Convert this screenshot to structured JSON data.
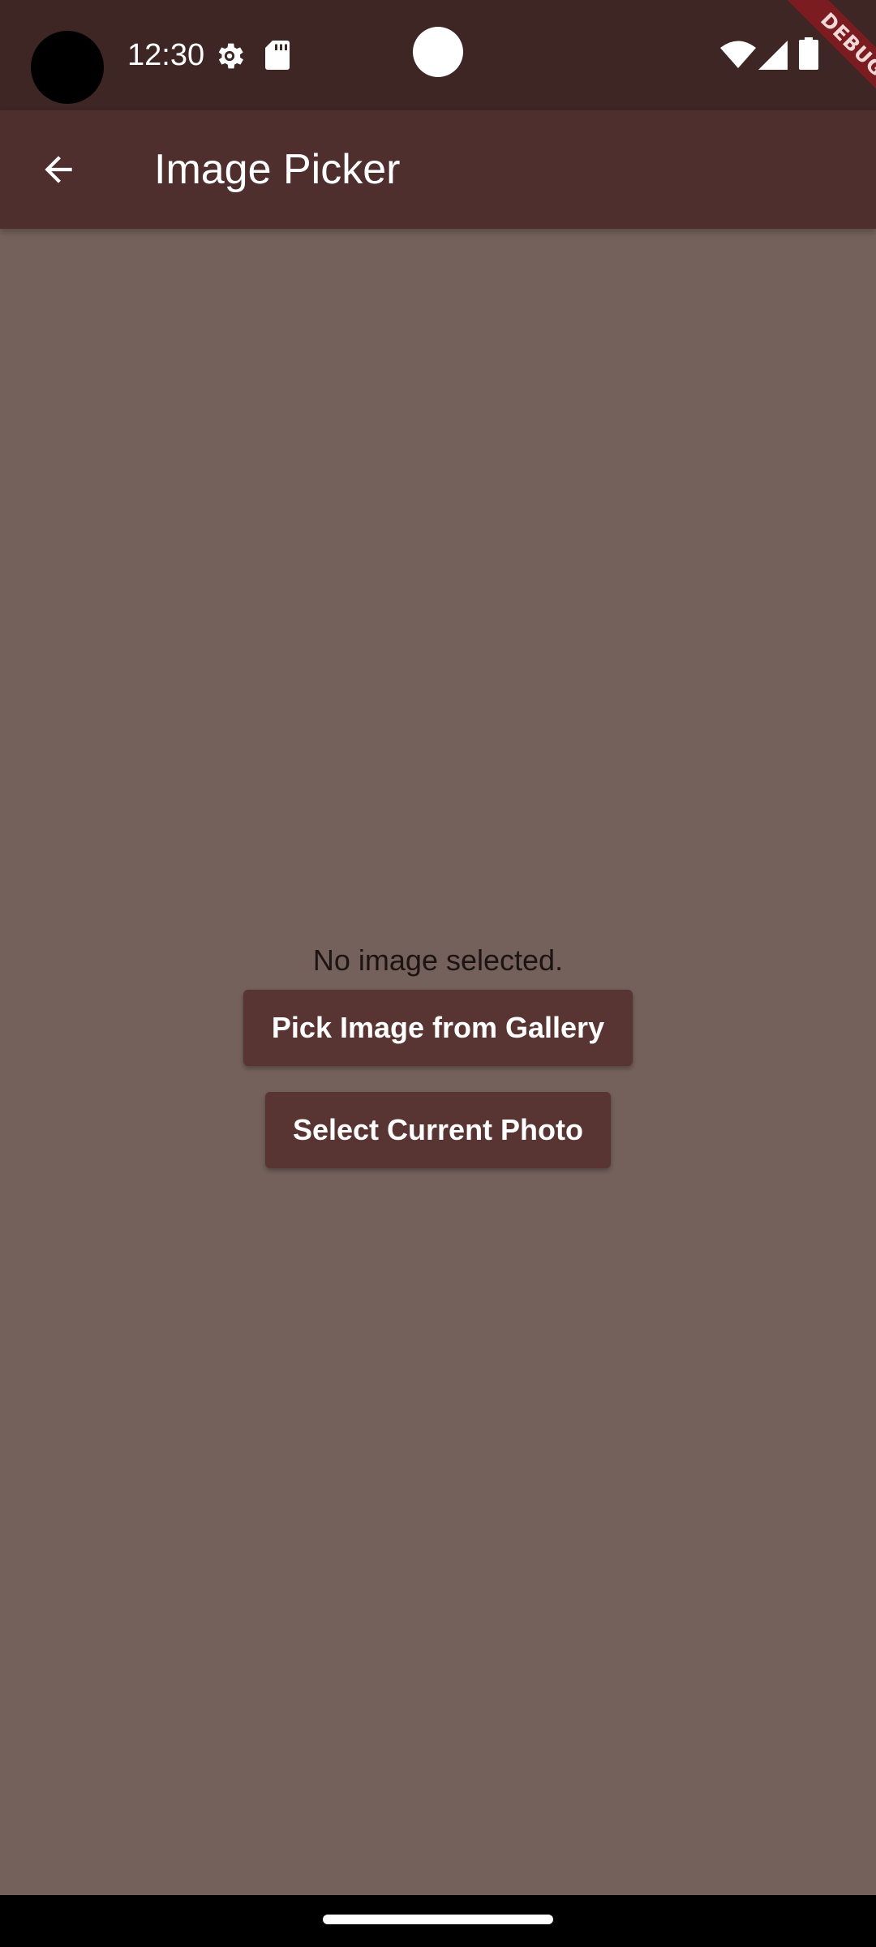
{
  "status_bar": {
    "time": "12:30",
    "icons": [
      "camera-cutout",
      "settings-gear-icon",
      "sd-card-icon",
      "notification-dot",
      "wifi-icon",
      "cell-signal-icon",
      "battery-icon"
    ]
  },
  "debug_banner": {
    "label": "DEBUG"
  },
  "app_bar": {
    "title": "Image Picker",
    "back_icon": "arrow-back-icon"
  },
  "content": {
    "status_text": "No image selected.",
    "pick_gallery_label": "Pick Image from Gallery",
    "select_current_label": "Select Current Photo"
  },
  "colors": {
    "status_bar": "#3d2624",
    "app_bar": "#4f2f2e",
    "background": "#74615b",
    "button": "#583432",
    "debug_ribbon": "#7b1d20"
  }
}
